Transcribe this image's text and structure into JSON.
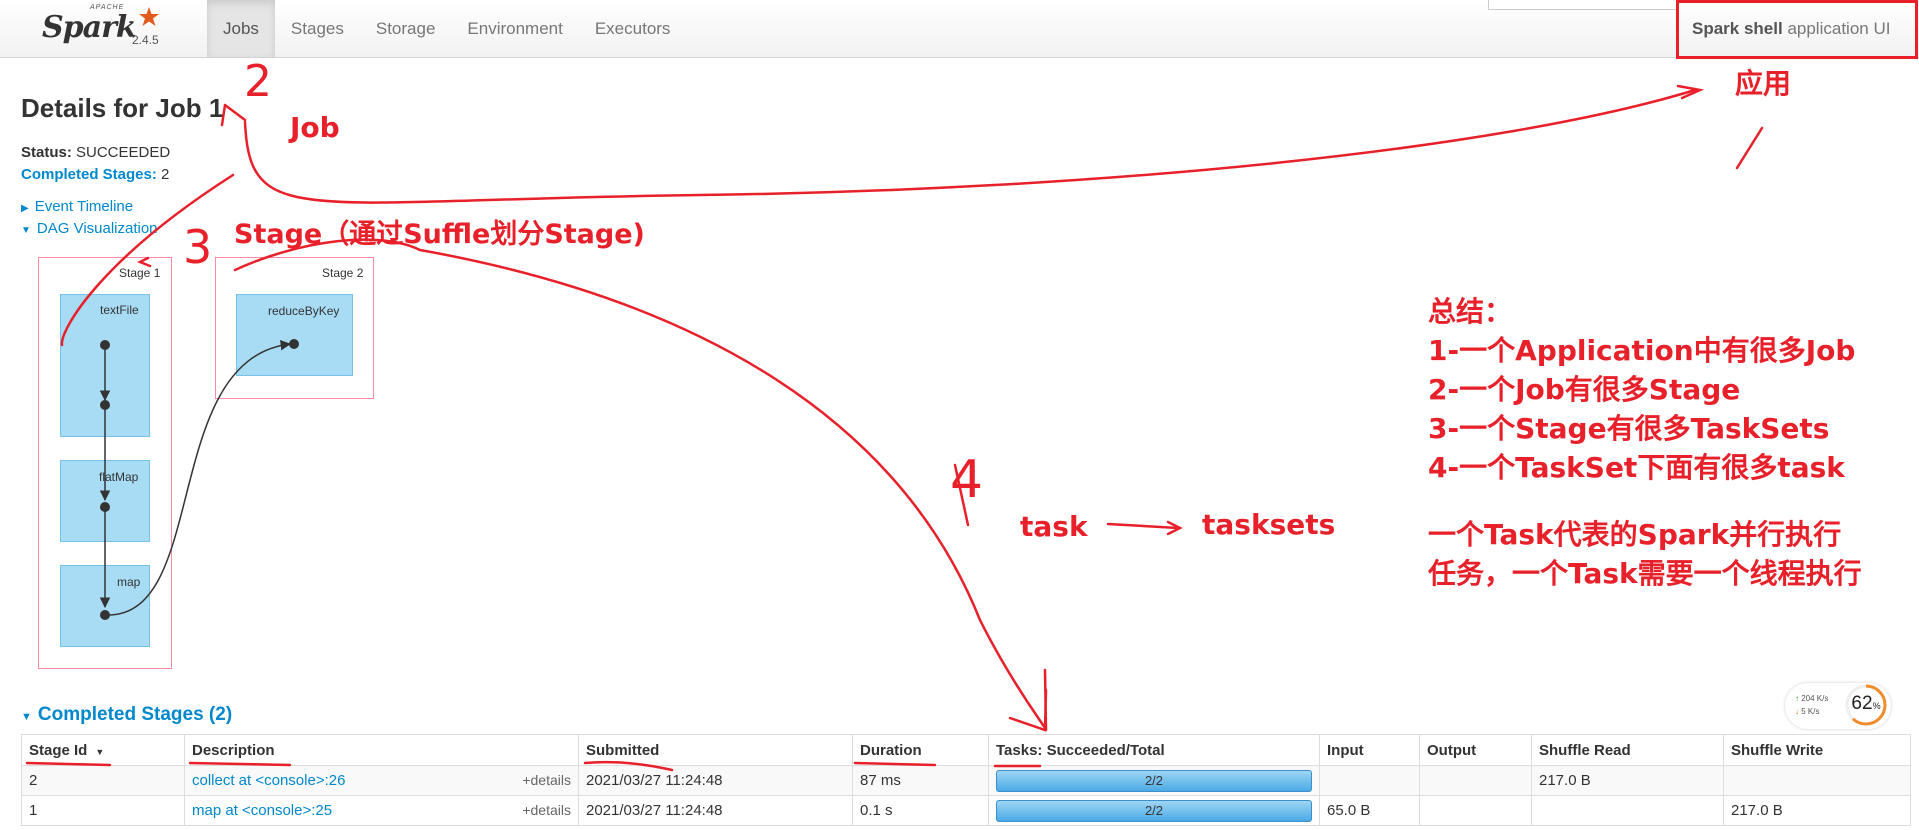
{
  "brand": {
    "apache": "APACHE",
    "name": "Spark",
    "version": "2.4.5"
  },
  "nav": {
    "tabs": [
      "Jobs",
      "Stages",
      "Storage",
      "Environment",
      "Executors"
    ],
    "active": "Jobs"
  },
  "app_title": {
    "bold": "Spark shell",
    "rest": " application UI"
  },
  "job": {
    "title": "Details for Job 1"
  },
  "status": {
    "label": "Status:",
    "value": "SUCCEEDED"
  },
  "completed_stages": {
    "label": "Completed Stages:",
    "value": "2"
  },
  "expanders": {
    "event_timeline": "Event Timeline",
    "dag": "DAG Visualization"
  },
  "dag": {
    "stages": [
      {
        "label": "Stage 1",
        "rdds": [
          "textFile",
          "flatMap",
          "map"
        ]
      },
      {
        "label": "Stage 2",
        "rdds": [
          "reduceByKey"
        ]
      }
    ]
  },
  "section": {
    "title": "Completed Stages (2)"
  },
  "table": {
    "headers": [
      "Stage Id",
      "Description",
      "Submitted",
      "Duration",
      "Tasks: Succeeded/Total",
      "Input",
      "Output",
      "Shuffle Read",
      "Shuffle Write"
    ],
    "details_label": "+details",
    "rows": [
      {
        "id": "2",
        "desc": "collect at <console>:26",
        "submitted": "2021/03/27 11:24:48",
        "duration": "87 ms",
        "tasks": "2/2",
        "tasks_fraction": 1.0,
        "input": "",
        "output": "",
        "shuffle_read": "217.0 B",
        "shuffle_write": ""
      },
      {
        "id": "1",
        "desc": "map at <console>:25",
        "submitted": "2021/03/27 11:24:48",
        "duration": "0.1 s",
        "tasks": "2/2",
        "tasks_fraction": 1.0,
        "input": "65.0 B",
        "output": "",
        "shuffle_read": "",
        "shuffle_write": "217.0 B"
      }
    ]
  },
  "net_widget": {
    "up": "204 K/s",
    "down": "5  K/s",
    "percent": "62",
    "percent_sign": "%"
  },
  "annotations": {
    "num2": "2",
    "job": "Job",
    "num3": "3",
    "stage": "Stage（通过Suffle划分Stage)",
    "app": "应用",
    "num4": "4",
    "task": "task",
    "tasksets": "tasksets"
  },
  "summary": [
    "总结：",
    "1-一个Application中有很多Job",
    "2-一个Job有很多Stage",
    "3-一个Stage有很多TaskSets",
    "4-一个TaskSet下面有很多task",
    "",
    "一个Task代表的Spark并行执行",
    "任务，一个Task需要一个线程执行"
  ],
  "colors": {
    "link": "#0088cc",
    "annotation": "#e8202a",
    "rdd": "#a8dcf5",
    "stage_border": "#ff8aa8"
  }
}
